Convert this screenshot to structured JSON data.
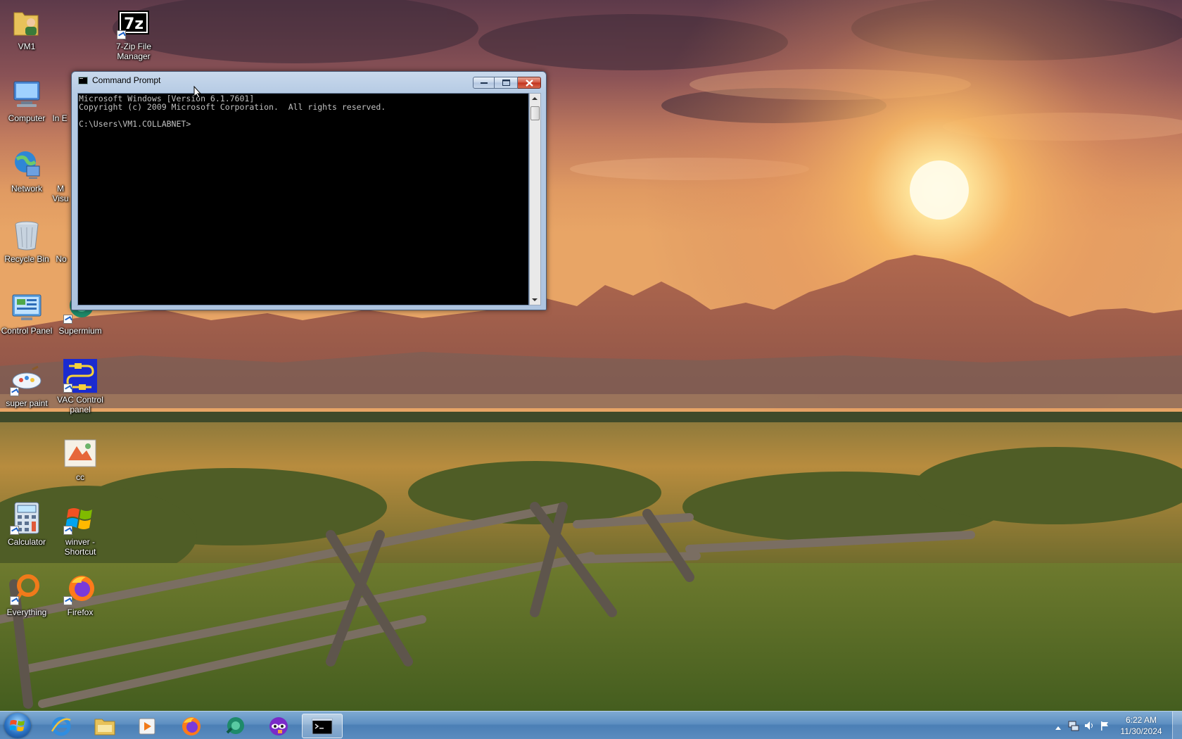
{
  "desktop": {
    "icons": [
      {
        "label": "VM1",
        "icon": "user-folder-icon"
      },
      {
        "label": "7-Zip File Manager",
        "icon": "7zip-icon"
      },
      {
        "label": "Computer",
        "icon": "computer-icon"
      },
      {
        "label": "In E",
        "icon": "internet-explorer-icon"
      },
      {
        "label": "Network",
        "icon": "network-icon"
      },
      {
        "label": "M Visu",
        "icon": "visual-studio-icon"
      },
      {
        "label": "Recycle Bin",
        "icon": "recycle-bin-icon"
      },
      {
        "label": "No",
        "icon": "notepad-icon"
      },
      {
        "label": "Control Panel",
        "icon": "control-panel-icon"
      },
      {
        "label": "Supermium",
        "icon": "supermium-icon"
      },
      {
        "label": "super paint",
        "icon": "paint-icon"
      },
      {
        "label": "VAC Control panel",
        "icon": "vac-control-panel-icon"
      },
      {
        "label": "cc",
        "icon": "image-file-icon"
      },
      {
        "label": "Calculator",
        "icon": "calculator-icon"
      },
      {
        "label": "winver - Shortcut",
        "icon": "windows-logo-icon"
      },
      {
        "label": "Everything",
        "icon": "everything-search-icon"
      },
      {
        "label": "Firefox",
        "icon": "firefox-icon"
      }
    ]
  },
  "cmd": {
    "title": "Command Prompt",
    "lines": [
      "Microsoft Windows [Version 6.1.7601]",
      "Copyright (c) 2009 Microsoft Corporation.  All rights reserved.",
      "",
      "C:\\Users\\VM1.COLLABNET>"
    ],
    "colors": {
      "background": "#000000",
      "text": "#c0c0c0"
    }
  },
  "taskbar": {
    "pinned": [
      {
        "name": "start-button",
        "icon": "windows-logo-icon"
      },
      {
        "name": "internet-explorer",
        "icon": "internet-explorer-icon"
      },
      {
        "name": "file-explorer",
        "icon": "folder-icon"
      },
      {
        "name": "media-player",
        "icon": "media-player-icon"
      },
      {
        "name": "firefox",
        "icon": "firefox-icon"
      },
      {
        "name": "supermium",
        "icon": "supermium-icon"
      },
      {
        "name": "mask-app",
        "icon": "mask-icon"
      },
      {
        "name": "command-prompt",
        "icon": "cmd-icon"
      }
    ],
    "tray": {
      "time": "6:22 AM",
      "date": "11/30/2024"
    }
  }
}
